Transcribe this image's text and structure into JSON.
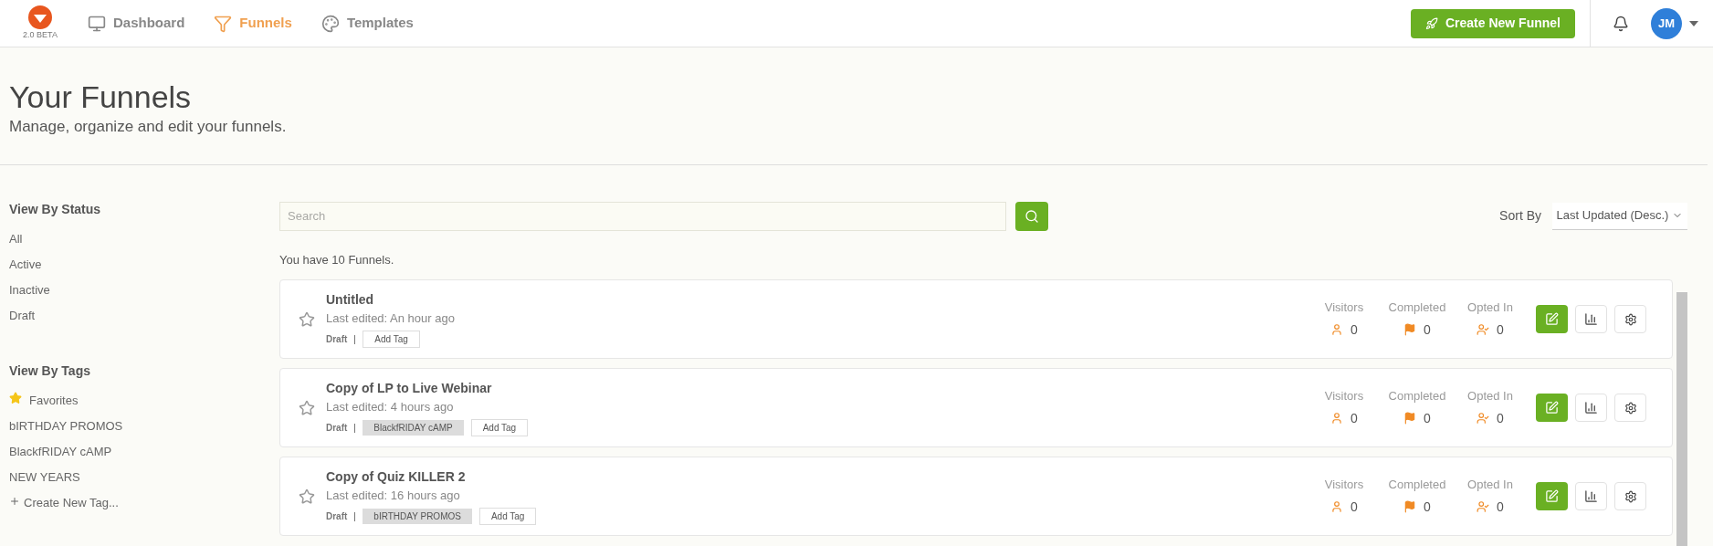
{
  "header": {
    "logo_caption": "2.0 BETA",
    "nav": [
      {
        "kind": "dashboard",
        "label": "Dashboard",
        "selected": false
      },
      {
        "kind": "funnels",
        "label": "Funnels",
        "selected": true
      },
      {
        "kind": "templates",
        "label": "Templates",
        "selected": false
      }
    ],
    "create_button": "Create New Funnel",
    "avatar": "JM"
  },
  "page": {
    "title": "Your Funnels",
    "subtitle": "Manage, organize and edit your funnels."
  },
  "sidebar": {
    "status_heading": "View By Status",
    "status_items": [
      "All",
      "Active",
      "Inactive",
      "Draft"
    ],
    "tags_heading": "View By Tags",
    "tag_items": [
      {
        "kind": "favorites",
        "label": "Favorites"
      },
      {
        "kind": "tag",
        "label": "bIRTHDAY PROMOS"
      },
      {
        "kind": "tag",
        "label": "BlackfRIDAY cAMP"
      },
      {
        "kind": "tag",
        "label": "NEW YEARS"
      },
      {
        "kind": "create",
        "label": "Create New Tag..."
      }
    ]
  },
  "search": {
    "placeholder": "Search"
  },
  "sort": {
    "label": "Sort By",
    "value": "Last Updated (Desc.)"
  },
  "count_text": "You have 10 Funnels.",
  "funnels": [
    {
      "name": "Untitled",
      "edited": "Last edited: An hour ago",
      "favorite": false,
      "status": "Draft",
      "add_tag": "Add Tag",
      "visitors_label": "Visitors",
      "visitors": "0",
      "completed_label": "Completed",
      "completed": "0",
      "opted_label": "Opted In",
      "opted": "0"
    },
    {
      "name": "Copy of LP to Live Webinar",
      "edited": "Last edited: 4 hours ago",
      "favorite": false,
      "status": "Draft",
      "tags": [
        "BlackfRIDAY cAMP"
      ],
      "add_tag": "Add Tag",
      "visitors_label": "Visitors",
      "visitors": "0",
      "completed_label": "Completed",
      "completed": "0",
      "opted_label": "Opted In",
      "opted": "0"
    },
    {
      "name": "Copy of Quiz KILLER 2",
      "edited": "Last edited: 16 hours ago",
      "favorite": false,
      "status": "Draft",
      "tags": [
        "bIRTHDAY PROMOS"
      ],
      "add_tag": "Add Tag",
      "visitors_label": "Visitors",
      "visitors": "0",
      "completed_label": "Completed",
      "completed": "0",
      "opted_label": "Opted In",
      "opted": "0"
    }
  ]
}
